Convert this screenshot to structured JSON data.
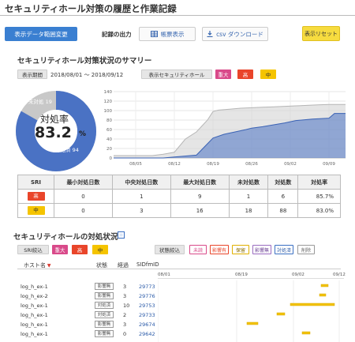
{
  "page": {
    "title": "セキュリティホール対策の履歴と作業記録"
  },
  "toolbar": {
    "change_range": "表示データ範囲変更",
    "output_label": "記録の出力",
    "table_view": "帳票表示",
    "csv_download": "csv ダウンロード",
    "reset": "表示リセット"
  },
  "summary": {
    "title": "セキュリティホール対策状況のサマリー",
    "period_label": "表示期間",
    "period_value": "2018/08/01 ～ 2018/09/12",
    "hall_label": "表示セキュリティホール",
    "badges": [
      "重大",
      "高",
      "中"
    ],
    "donut": {
      "untreated_label": "未対処",
      "untreated_count": "19",
      "treated_label": "対処済",
      "treated_count": "94",
      "ratio_label": "対処率",
      "ratio_value": "83.2",
      "ratio_unit": "%",
      "treated_color": "#4a72c4",
      "untreated_color": "#c8c8c8"
    }
  },
  "chart_data": {
    "type": "area",
    "x_tick_labels": [
      "08/05",
      "08/12",
      "08/19",
      "08/26",
      "09/02",
      "09/09"
    ],
    "y_tick_labels": [
      "0",
      "20",
      "40",
      "60",
      "80",
      "100",
      "120",
      "140"
    ],
    "ylim": [
      0,
      140
    ],
    "grid": true,
    "series": [
      {
        "x": [
          "08/01",
          "08/08",
          "08/10",
          "08/12",
          "08/14",
          "08/16",
          "08/18",
          "08/19",
          "08/20",
          "08/22",
          "08/24",
          "08/26",
          "08/28",
          "08/30",
          "09/01",
          "09/03",
          "09/05",
          "09/07",
          "09/09",
          "09/10",
          "09/12"
        ],
        "values": [
          5,
          5,
          8,
          12,
          40,
          55,
          80,
          98,
          101,
          103,
          105,
          106,
          107,
          108,
          109,
          110,
          111,
          112,
          113,
          113,
          113
        ],
        "color": "#cfcfcf"
      },
      {
        "x": [
          "08/01",
          "08/10",
          "08/12",
          "08/16",
          "08/18",
          "08/19",
          "08/21",
          "08/23",
          "08/25",
          "08/26",
          "08/28",
          "08/30",
          "09/01",
          "09/03",
          "09/06",
          "09/09",
          "09/10",
          "09/12"
        ],
        "values": [
          0,
          0,
          2,
          6,
          30,
          42,
          50,
          55,
          60,
          63,
          66,
          70,
          74,
          79,
          82,
          84,
          94,
          94
        ],
        "color": "#4a72c4"
      }
    ]
  },
  "sri_table": {
    "headers": [
      "SRI",
      "最小対処日数",
      "中央対処日数",
      "最大対処日数",
      "未対処数",
      "対処数",
      "対処率"
    ],
    "rows": [
      {
        "sri": "高",
        "min": "0",
        "median": "1",
        "max": "9",
        "untreated": "1",
        "treated": "6",
        "rate": "85.7%"
      },
      {
        "sri": "中",
        "min": "0",
        "median": "3",
        "max": "16",
        "untreated": "18",
        "treated": "88",
        "rate": "83.0%"
      }
    ]
  },
  "status": {
    "title": "セキュリティホールの対処状況",
    "sri_filter_label": "SRI絞込",
    "sri_badges": [
      "重大",
      "高",
      "中"
    ],
    "state_filter_label": "状態絞込",
    "state_badges": [
      "未読",
      "影響有",
      "保留",
      "影響無",
      "対処済",
      "削除"
    ],
    "columns": [
      "ホスト名",
      "状態",
      "経過",
      "SIDfmID"
    ],
    "timeline_ticks": [
      "08/01",
      "08/19",
      "09/02",
      "09/12"
    ],
    "rows": [
      {
        "host": "log_h_ex-1",
        "state": "影響無",
        "elapsed": "3",
        "sid": "29773"
      },
      {
        "host": "log_h_ex-2",
        "state": "影響無",
        "elapsed": "3",
        "sid": "29776"
      },
      {
        "host": "log_h_ex-1",
        "state": "対処済",
        "elapsed": "10",
        "sid": "29753"
      },
      {
        "host": "log_h_ex-1",
        "state": "対処済",
        "elapsed": "2",
        "sid": "29733"
      },
      {
        "host": "log_h_ex-1",
        "state": "影響無",
        "elapsed": "3",
        "sid": "29674"
      },
      {
        "host": "log_h_ex-1",
        "state": "影響無",
        "elapsed": "0",
        "sid": "29642"
      }
    ],
    "bar_color": "#f2c20a"
  }
}
